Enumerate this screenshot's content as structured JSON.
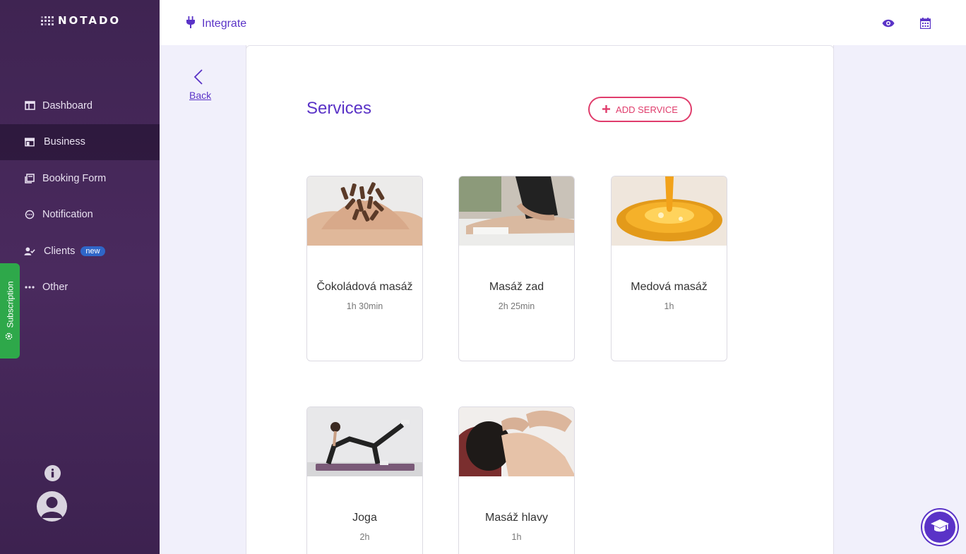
{
  "app": {
    "name": "NOTADO"
  },
  "sidebar": {
    "items": [
      {
        "label": "Dashboard",
        "icon": "dashboard-icon"
      },
      {
        "label": "Business",
        "icon": "store-icon",
        "active": true
      },
      {
        "label": "Booking Form",
        "icon": "form-icon"
      },
      {
        "label": "Notification",
        "icon": "chat-icon"
      },
      {
        "label": "Clients",
        "icon": "user-check-icon",
        "badge": "new"
      },
      {
        "label": "Other",
        "icon": "more-icon"
      }
    ],
    "subscription_label": "Subscription"
  },
  "topbar": {
    "integrate_label": "Integrate"
  },
  "back_label": "Back",
  "services": {
    "title": "Services",
    "add_label": "ADD SERVICE",
    "items": [
      {
        "name": "Čokoládová masáž",
        "duration": "1h 30min"
      },
      {
        "name": "Masáž zad",
        "duration": "2h 25min"
      },
      {
        "name": "Medová masáž",
        "duration": "1h"
      },
      {
        "name": "Joga",
        "duration": "2h"
      },
      {
        "name": "Masáž hlavy",
        "duration": "1h"
      }
    ]
  },
  "colors": {
    "accent": "#5a33c7",
    "danger": "#e03d6c",
    "sidebar": "#3f2452",
    "subscription": "#2ea84a"
  }
}
